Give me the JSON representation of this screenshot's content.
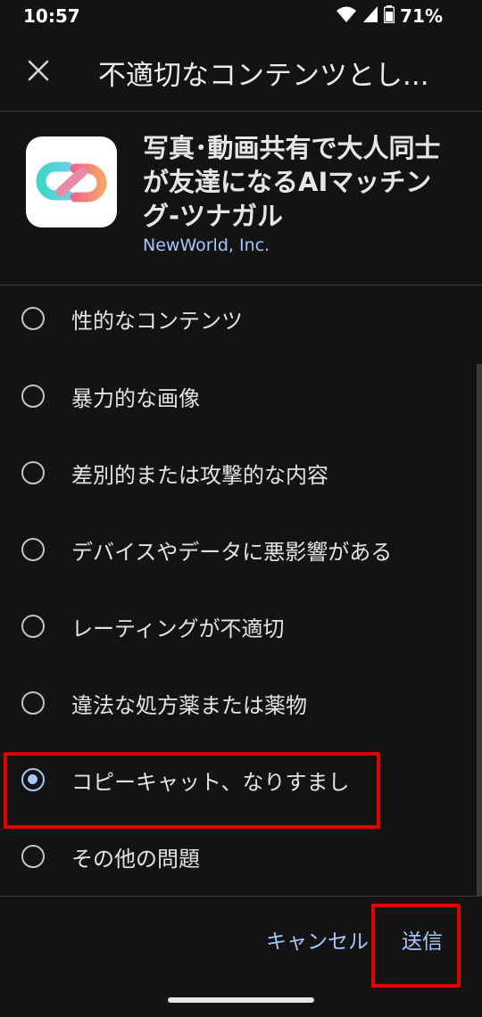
{
  "status_bar": {
    "time": "10:57",
    "battery": "71%"
  },
  "header": {
    "title": "不適切なコンテンツとし..."
  },
  "app": {
    "name": "写真･動画共有で大人同士が友達になるAIマッチング-ツナガル",
    "developer": "NewWorld, Inc."
  },
  "options": [
    {
      "label": "性的なコンテンツ",
      "selected": false
    },
    {
      "label": "暴力的な画像",
      "selected": false
    },
    {
      "label": "差別的または攻撃的な内容",
      "selected": false
    },
    {
      "label": "デバイスやデータに悪影響がある",
      "selected": false
    },
    {
      "label": "レーティングが不適切",
      "selected": false
    },
    {
      "label": "違法な処方薬または薬物",
      "selected": false
    },
    {
      "label": "コピーキャット、なりすまし",
      "selected": true
    },
    {
      "label": "その他の問題",
      "selected": false
    }
  ],
  "actions": {
    "cancel": "キャンセル",
    "submit": "送信"
  },
  "colors": {
    "background": "#131313",
    "accent": "#a8c7fa",
    "highlight": "#e00000"
  }
}
